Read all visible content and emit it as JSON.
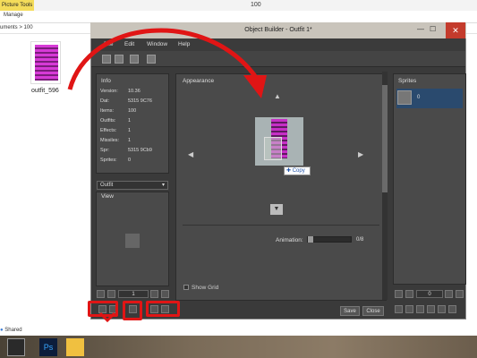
{
  "explorer": {
    "picture_tools": "Picture Tools",
    "title": "100",
    "manage_tab": "Manage",
    "address": "uments  >  100",
    "file_label": "outfit_596",
    "status": "Shared"
  },
  "window": {
    "title": "Object Builder - Outfit 1*",
    "close": "✕",
    "max": "☐",
    "min": "—",
    "menus": [
      "File",
      "Edit",
      "Window",
      "Help"
    ]
  },
  "info": {
    "title": "Info",
    "rows": [
      {
        "label": "Version:",
        "value": "10.36"
      },
      {
        "label": "Dat:",
        "value": "5315 9C76"
      },
      {
        "label": "Items:",
        "value": "100"
      },
      {
        "label": "Outfits:",
        "value": "1"
      },
      {
        "label": "Effects:",
        "value": "1"
      },
      {
        "label": "Missiles:",
        "value": "1"
      },
      {
        "label": "Spr:",
        "value": "5315 9Cb9"
      },
      {
        "label": "Sprites:",
        "value": "0"
      }
    ]
  },
  "left": {
    "select_value": "Outfit",
    "view_title": "View",
    "stepper_value": "1"
  },
  "appearance": {
    "title": "Appearance",
    "copy_tip": "Copy",
    "animation_label": "Animation:",
    "animation_count": "0/8",
    "animation_fraction": 0,
    "show_grid": "Show Grid",
    "save": "Save",
    "close": "Close"
  },
  "sprites": {
    "title": "Sprites",
    "first_id": "0",
    "stepper_value": "0"
  }
}
